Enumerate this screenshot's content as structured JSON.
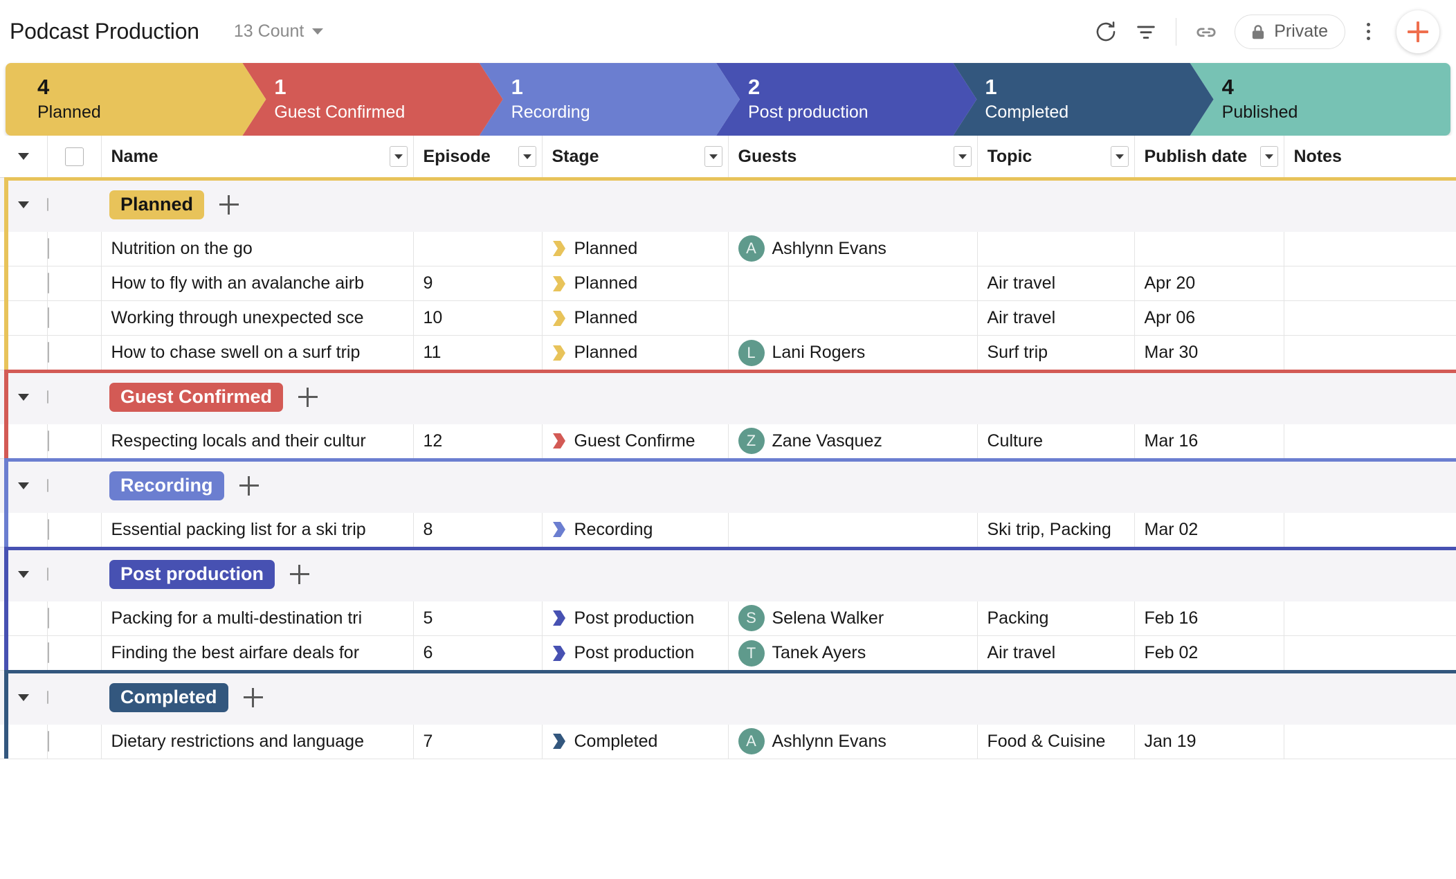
{
  "header": {
    "title": "Podcast Production",
    "count_label": "13 Count",
    "refresh_icon": "refresh-icon",
    "filter_icon": "filter-icon",
    "link_icon": "link-icon",
    "lock_icon": "lock-icon",
    "private_label": "Private",
    "kebab_icon": "more-vertical-icon",
    "add_icon": "plus-icon"
  },
  "pipeline": [
    {
      "count": "4",
      "label": "Planned",
      "color": "#e8c35a",
      "text": "dark"
    },
    {
      "count": "1",
      "label": "Guest Confirmed",
      "color": "#d35a55",
      "text": "light"
    },
    {
      "count": "1",
      "label": "Recording",
      "color": "#6b7ed0",
      "text": "light"
    },
    {
      "count": "2",
      "label": "Post production",
      "color": "#4751b2",
      "text": "light"
    },
    {
      "count": "1",
      "label": "Completed",
      "color": "#33577e",
      "text": "light"
    },
    {
      "count": "4",
      "label": "Published",
      "color": "#77c2b4",
      "text": "dark"
    }
  ],
  "columns": [
    {
      "key": "name",
      "label": "Name",
      "has_dropdown": true
    },
    {
      "key": "episode",
      "label": "Episode",
      "has_dropdown": true
    },
    {
      "key": "stage",
      "label": "Stage",
      "has_dropdown": true
    },
    {
      "key": "guests",
      "label": "Guests",
      "has_dropdown": true
    },
    {
      "key": "topic",
      "label": "Topic",
      "has_dropdown": true
    },
    {
      "key": "date",
      "label": "Publish date",
      "has_dropdown": true
    },
    {
      "key": "notes",
      "label": "Notes",
      "has_dropdown": false
    }
  ],
  "groups": [
    {
      "label": "Planned",
      "color": "#e8c35a",
      "badge_text": "dark",
      "rows": [
        {
          "name": "Nutrition on the go",
          "episode": "",
          "stage": "Planned",
          "guest": "Ashlynn Evans",
          "avatar": "A",
          "topic": "",
          "date": "",
          "notes": ""
        },
        {
          "name": "How to fly with an avalanche airb",
          "episode": "9",
          "stage": "Planned",
          "guest": "",
          "avatar": "",
          "topic": "Air travel",
          "date": "Apr 20",
          "notes": ""
        },
        {
          "name": "Working through unexpected sce",
          "episode": "10",
          "stage": "Planned",
          "guest": "",
          "avatar": "",
          "topic": "Air travel",
          "date": "Apr 06",
          "notes": ""
        },
        {
          "name": "How to chase swell on a surf trip",
          "episode": "11",
          "stage": "Planned",
          "guest": "Lani Rogers",
          "avatar": "L",
          "topic": "Surf trip",
          "date": "Mar 30",
          "notes": ""
        }
      ]
    },
    {
      "label": "Guest Confirmed",
      "color": "#d35a55",
      "badge_text": "light",
      "rows": [
        {
          "name": "Respecting locals and their cultur",
          "episode": "12",
          "stage": "Guest Confirme",
          "guest": "Zane Vasquez",
          "avatar": "Z",
          "topic": "Culture",
          "date": "Mar 16",
          "notes": ""
        }
      ]
    },
    {
      "label": "Recording",
      "color": "#6b7ed0",
      "badge_text": "light",
      "rows": [
        {
          "name": "Essential packing list for a ski trip",
          "episode": "8",
          "stage": "Recording",
          "guest": "",
          "avatar": "",
          "topic": "Ski trip, Packing",
          "date": "Mar 02",
          "notes": ""
        }
      ]
    },
    {
      "label": "Post production",
      "color": "#4751b2",
      "badge_text": "light",
      "rows": [
        {
          "name": "Packing for a multi-destination tri",
          "episode": "5",
          "stage": "Post production",
          "guest": "Selena Walker",
          "avatar": "S",
          "topic": "Packing",
          "date": "Feb 16",
          "notes": ""
        },
        {
          "name": "Finding the best airfare deals for",
          "episode": "6",
          "stage": "Post production",
          "guest": "Tanek Ayers",
          "avatar": "T",
          "topic": "Air travel",
          "date": "Feb 02",
          "notes": ""
        }
      ]
    },
    {
      "label": "Completed",
      "color": "#33577e",
      "badge_text": "light",
      "rows": [
        {
          "name": "Dietary restrictions and language",
          "episode": "7",
          "stage": "Completed",
          "guest": "Ashlynn Evans",
          "avatar": "A",
          "topic": "Food & Cuisine",
          "date": "Jan 19",
          "notes": ""
        }
      ]
    }
  ]
}
